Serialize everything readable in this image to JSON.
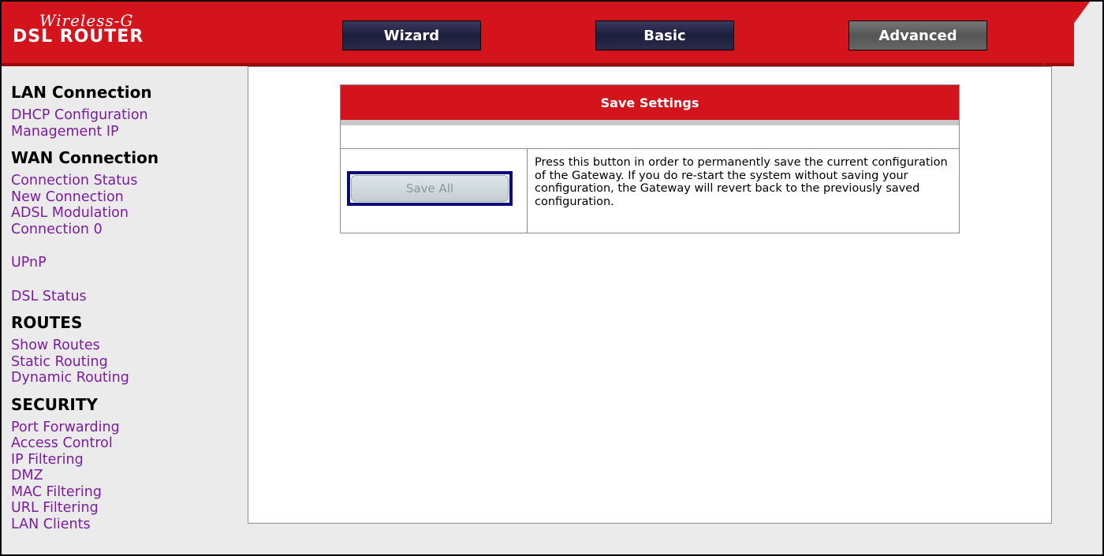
{
  "header": {
    "logo_top": "Wireless-G",
    "logo_bottom": "DSL ROUTER",
    "nav": {
      "wizard": "Wizard",
      "basic": "Basic",
      "advanced": "Advanced"
    },
    "colors": {
      "brand_red": "#d3141c",
      "nav_dark": "#1d1d3d",
      "nav_active_gray": "#555555"
    }
  },
  "sidebar": {
    "lan": {
      "title": "LAN Connection",
      "items": [
        "DHCP Configuration",
        "Management IP"
      ]
    },
    "wan": {
      "title": "WAN Connection",
      "items": [
        "Connection Status",
        "New Connection",
        "ADSL Modulation",
        "Connection 0"
      ]
    },
    "upnp": "UPnP",
    "dsl_status": "DSL Status",
    "routes": {
      "title": "ROUTES",
      "items": [
        "Show Routes",
        "Static Routing",
        "Dynamic Routing"
      ]
    },
    "security": {
      "title": "SECURITY",
      "items": [
        "Port Forwarding",
        "Access Control",
        "IP Filtering",
        "DMZ",
        "MAC Filtering",
        "URL Filtering",
        "LAN Clients"
      ]
    },
    "link_color": "#7a1d9c"
  },
  "main": {
    "panel_title": "Save Settings",
    "save_button": "Save All",
    "description": "Press this button in order to permanently save the current configuration of the Gateway. If you do re-start the system without saving your configuration, the Gateway will revert back to the previously saved configuration."
  }
}
